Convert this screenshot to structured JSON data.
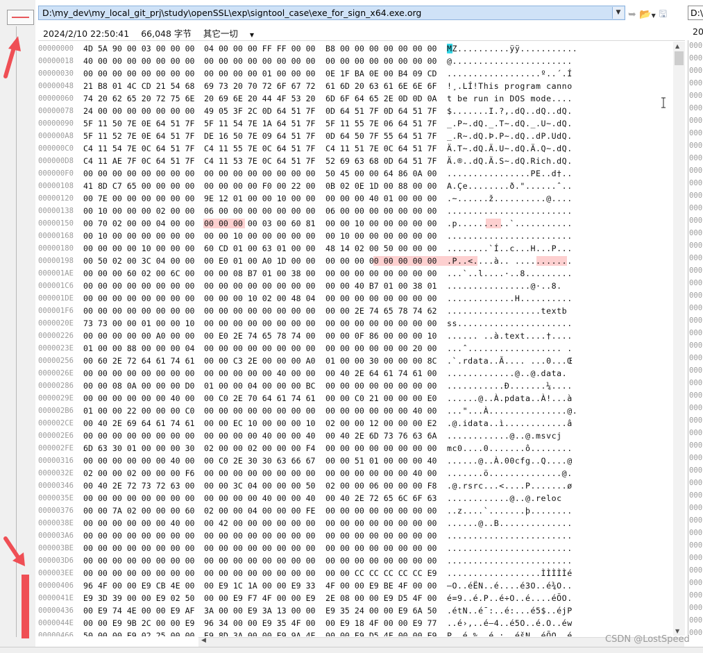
{
  "toolbar": {
    "path": "D:\\my_dev\\my_local_git_prj\\study\\openSSL\\exp\\signtool_case\\exe_for_sign_x64.exe.org",
    "right_path": "D:\\"
  },
  "info": {
    "date": "2024/2/10 22:50:41",
    "size": "66,048 字节",
    "mode": "其它一切",
    "right_date": "20"
  },
  "hex_rows": [
    {
      "off": "00000000",
      "h": [
        "4D 5A 90 00 03 00 00 00",
        "04 00 00 00 FF FF 00 00",
        "B8 00 00 00 00 00 00 00"
      ],
      "a": "MZ..........ÿÿ..........."
    },
    {
      "off": "00000018",
      "h": [
        "40 00 00 00 00 00 00 00",
        "00 00 00 00 00 00 00 00",
        "00 00 00 00 00 00 00 00"
      ],
      "a": "@......................."
    },
    {
      "off": "00000030",
      "h": [
        "00 00 00 00 00 00 00 00",
        "00 00 00 00 01 00 00 00",
        "0E 1F BA 0E 00 B4 09 CD"
      ],
      "a": "..................º..´.Í"
    },
    {
      "off": "00000048",
      "h": [
        "21 B8 01 4C CD 21 54 68",
        "69 73 20 70 72 6F 67 72",
        "61 6D 20 63 61 6E 6E 6F"
      ],
      "a": "!¸.LÍ!This program canno"
    },
    {
      "off": "00000060",
      "h": [
        "74 20 62 65 20 72 75 6E",
        "20 69 6E 20 44 4F 53 20",
        "6D 6F 64 65 2E 0D 0D 0A"
      ],
      "a": "t be run in DOS mode...."
    },
    {
      "off": "00000078",
      "h": [
        "24 00 00 00 00 00 00 00",
        "49 05 3F 2C 0D 64 51 7F",
        "0D 64 51 7F 0D 64 51 7F"
      ],
      "a": "$.......I.?,.dQ..dQ..dQ."
    },
    {
      "off": "00000090",
      "h": [
        "5F 11 50 7E 0E 64 51 7F",
        "5F 11 54 7E 1A 64 51 7F",
        "5F 11 55 7E 06 64 51 7F"
      ],
      "a": "_.P~.dQ._.T~.dQ._.U~.dQ."
    },
    {
      "off": "000000A8",
      "h": [
        "5F 11 52 7E 0E 64 51 7F",
        "DE 16 50 7E 09 64 51 7F",
        "0D 64 50 7F 55 64 51 7F"
      ],
      "a": "_.R~.dQ.Þ.P~.dQ..dP.UdQ."
    },
    {
      "off": "000000C0",
      "h": [
        "C4 11 54 7E 0C 64 51 7F",
        "C4 11 55 7E 0C 64 51 7F",
        "C4 11 51 7E 0C 64 51 7F"
      ],
      "a": "Ä.T~.dQ.Ä.U~.dQ.Ä.Q~.dQ."
    },
    {
      "off": "000000D8",
      "h": [
        "C4 11 AE 7F 0C 64 51 7F",
        "C4 11 53 7E 0C 64 51 7F",
        "52 69 63 68 0D 64 51 7F"
      ],
      "a": "Ä.®..dQ.Ä.S~.dQ.Rich.dQ."
    },
    {
      "off": "000000F0",
      "h": [
        "00 00 00 00 00 00 00 00",
        "00 00 00 00 00 00 00 00",
        "50 45 00 00 64 86 0A 00"
      ],
      "a": "................PE..d†.."
    },
    {
      "off": "00000108",
      "h": [
        "41 8D C7 65 00 00 00 00",
        "00 00 00 00 F0 00 22 00",
        "0B 02 0E 1D 00 88 00 00"
      ],
      "a": "A.Çe........ð.\"......ˆ.."
    },
    {
      "off": "00000120",
      "h": [
        "00 7E 00 00 00 00 00 00",
        "9E 12 01 00 00 10 00 00",
        "00 00 00 40 01 00 00 00"
      ],
      "a": ".~......ž..........@...."
    },
    {
      "off": "00000138",
      "h": [
        "00 10 00 00 00 02 00 00",
        "06 00 00 00 00 00 00 00",
        "06 00 00 00 00 00 00 00"
      ],
      "a": "........................"
    },
    {
      "off": "00000150",
      "h": [
        "00 70 02 00 00 04 00 00",
        "00 00 00 00 03 00 60 81",
        "00 00 10 00 00 00 00 00"
      ],
      "a": ".p..........`..........."
    },
    {
      "off": "00000168",
      "h": [
        "00 10 00 00 00 00 00 00",
        "00 00 10 00 00 00 00 00",
        "00 10 00 00 00 00 00 00"
      ],
      "a": "........................"
    },
    {
      "off": "00000180",
      "h": [
        "00 00 00 00 10 00 00 00",
        "60 CD 01 00 63 01 00 00",
        "48 14 02 00 50 00 00 00"
      ],
      "a": "........`Í..c...H...P..."
    },
    {
      "off": "00000198",
      "h": [
        "00 50 02 00 3C 04 00 00",
        "00 E0 01 00 A0 1D 00 00",
        "00 00 00 00 00 00 00 00"
      ],
      "a": ".P..<....à.. ..........."
    },
    {
      "off": "000001AE",
      "h": [
        "00 00 00 60 02 00 6C 00",
        "00 00 08 B7 01 00 38 00",
        "00 00 00 00 00 00 00 00"
      ],
      "a": "...`..l....·..8........."
    },
    {
      "off": "000001C6",
      "h": [
        "00 00 00 00 00 00 00 00",
        "00 00 00 00 00 00 00 00",
        "00 00 40 B7 01 00 38 01"
      ],
      "a": "................@·..8."
    },
    {
      "off": "000001DE",
      "h": [
        "00 00 00 00 00 00 00 00",
        "00 00 00 10 02 00 48 04",
        "00 00 00 00 00 00 00 00"
      ],
      "a": ".............H.........."
    },
    {
      "off": "000001F6",
      "h": [
        "00 00 00 00 00 00 00 00",
        "00 00 00 00 00 00 00 00",
        "00 00 2E 74 65 78 74 62"
      ],
      "a": "..................textb"
    },
    {
      "off": "0000020E",
      "h": [
        "73 73 00 00 01 00 00 10",
        "00 00 00 00 00 00 00 00",
        "00 00 00 00 00 00 00 00"
      ],
      "a": "ss......................"
    },
    {
      "off": "00000226",
      "h": [
        "00 00 00 00 00 A0 00 00",
        "00 E0 2E 74 65 78 74 00",
        "00 00 0F 86 00 00 00 10"
      ],
      "a": "...... ..à.text....†...."
    },
    {
      "off": "0000023E",
      "h": [
        "01 00 00 88 00 00 00 04",
        "00 00 00 00 00 00 00 00",
        "00 00 00 00 00 00 20 00"
      ],
      "a": "...ˆ.................. ."
    },
    {
      "off": "00000256",
      "h": [
        "00 60 2E 72 64 61 74 61",
        "00 00 C3 2E 00 00 00 A0",
        "01 00 00 30 00 00 00 8C"
      ],
      "a": ".`.rdata..Ã.... ...0...Œ"
    },
    {
      "off": "0000026E",
      "h": [
        "00 00 00 00 00 00 00 00",
        "00 00 00 00 00 40 00 00",
        "00 40 2E 64 61 74 61 00"
      ],
      "a": ".............@..@.data."
    },
    {
      "off": "00000286",
      "h": [
        "00 00 08 0A 00 00 00 D0",
        "01 00 00 04 00 00 00 BC",
        "00 00 00 00 00 00 00 00"
      ],
      "a": "...........Ð.......¼...."
    },
    {
      "off": "0000029E",
      "h": [
        "00 00 00 00 00 00 40 00",
        "00 C0 2E 70 64 61 74 61",
        "00 00 C0 21 00 00 00 E0"
      ],
      "a": "......@..À.pdata..À!...à"
    },
    {
      "off": "000002B6",
      "h": [
        "01 00 00 22 00 00 00 C0",
        "00 00 00 00 00 00 00 00",
        "00 00 00 00 00 00 40 00"
      ],
      "a": "...\"...À...............@."
    },
    {
      "off": "000002CE",
      "h": [
        "00 40 2E 69 64 61 74 61",
        "00 00 EC 10 00 00 00 10",
        "02 00 00 12 00 00 00 E2"
      ],
      "a": ".@.idata..ì............â"
    },
    {
      "off": "000002E6",
      "h": [
        "00 00 00 00 00 00 00 00",
        "00 00 00 00 40 00 00 40",
        "00 40 2E 6D 73 76 63 6A"
      ],
      "a": "............@..@.msvcj"
    },
    {
      "off": "000002FE",
      "h": [
        "6D 63 30 01 00 00 00 30",
        "02 00 00 02 00 00 00 F4",
        "00 00 00 00 00 00 00 00"
      ],
      "a": "mc0....0.......ô........"
    },
    {
      "off": "00000316",
      "h": [
        "00 00 00 00 00 00 40 00",
        "00 C0 2E 30 30 63 66 67",
        "00 00 51 01 00 00 00 40"
      ],
      "a": "......@..À.00cfg..Q....@"
    },
    {
      "off": "0000032E",
      "h": [
        "02 00 00 02 00 00 00 F6",
        "00 00 00 00 00 00 00 00",
        "00 00 00 00 00 00 40 00"
      ],
      "a": ".......ö..............@."
    },
    {
      "off": "00000346",
      "h": [
        "00 40 2E 72 73 72 63 00",
        "00 00 3C 04 00 00 00 50",
        "02 00 00 06 00 00 00 F8"
      ],
      "a": ".@.rsrc...<....P.......ø"
    },
    {
      "off": "0000035E",
      "h": [
        "00 00 00 00 00 00 00 00",
        "00 00 00 00 40 00 00 40",
        "00 40 2E 72 65 6C 6F 63"
      ],
      "a": "............@..@.reloc"
    },
    {
      "off": "00000376",
      "h": [
        "00 00 7A 02 00 00 00 60",
        "02 00 00 04 00 00 00 FE",
        "00 00 00 00 00 00 00 00"
      ],
      "a": "..z....`.......þ........"
    },
    {
      "off": "0000038E",
      "h": [
        "00 00 00 00 00 00 40 00",
        "00 42 00 00 00 00 00 00",
        "00 00 00 00 00 00 00 00"
      ],
      "a": "......@..B.............."
    },
    {
      "off": "000003A6",
      "h": [
        "00 00 00 00 00 00 00 00",
        "00 00 00 00 00 00 00 00",
        "00 00 00 00 00 00 00 00"
      ],
      "a": "........................"
    },
    {
      "off": "000003BE",
      "h": [
        "00 00 00 00 00 00 00 00",
        "00 00 00 00 00 00 00 00",
        "00 00 00 00 00 00 00 00"
      ],
      "a": "........................"
    },
    {
      "off": "000003D6",
      "h": [
        "00 00 00 00 00 00 00 00",
        "00 00 00 00 00 00 00 00",
        "00 00 00 00 00 00 00 00"
      ],
      "a": "........................"
    },
    {
      "off": "000003EE",
      "h": [
        "00 00 00 00 00 00 00 00",
        "00 00 00 00 00 00 00 00",
        "00 00 CC CC CC CC CC E9"
      ],
      "a": "..................ÌÌÌÌÌé"
    },
    {
      "off": "00000406",
      "h": [
        "96 4F 00 00 E9 CB 4E 00",
        "00 E9 1C 1A 00 00 E9 33",
        "4F 00 00 E9 BE 4F 00 00"
      ],
      "a": "–O..éËN..é....é3O..é¾O.."
    },
    {
      "off": "0000041E",
      "h": [
        "E9 3D 39 00 00 E9 02 50",
        "00 00 E9 F7 4F 00 00 E9",
        "2E 08 00 00 E9 D5 4F 00"
      ],
      "a": "é=9..é.P..é÷O..é....éÕO."
    },
    {
      "off": "00000436",
      "h": [
        "00 E9 74 4E 00 00 E9 AF",
        "3A 00 00 E9 3A 13 00 00",
        "E9 35 24 00 00 E9 6A 50"
      ],
      "a": ".étN..é¯:..é:...é5$..éjP"
    },
    {
      "off": "0000044E",
      "h": [
        "00 00 E9 9B 2C 00 00 E9",
        "96 34 00 00 E9 35 4F 00",
        "00 E9 18 4F 00 00 E9 77"
      ],
      "a": "..é›,..é–4..é5O..é.O..éw"
    },
    {
      "off": "00000466",
      "h": [
        "50 00 00 E9 02 25 00 00",
        "E9 8D 3A 00 00 E9 9A 4E",
        "00 00 E9 D5 4F 00 00 E9"
      ],
      "a": "P..é.%..é.:..éšN..éÕO..é"
    }
  ],
  "watermark": "CSDN @LostSpeed",
  "colors": {
    "accent": "#cfe2f7",
    "highlight": "#fdd0d0",
    "mark_red": "#ef4f55"
  }
}
